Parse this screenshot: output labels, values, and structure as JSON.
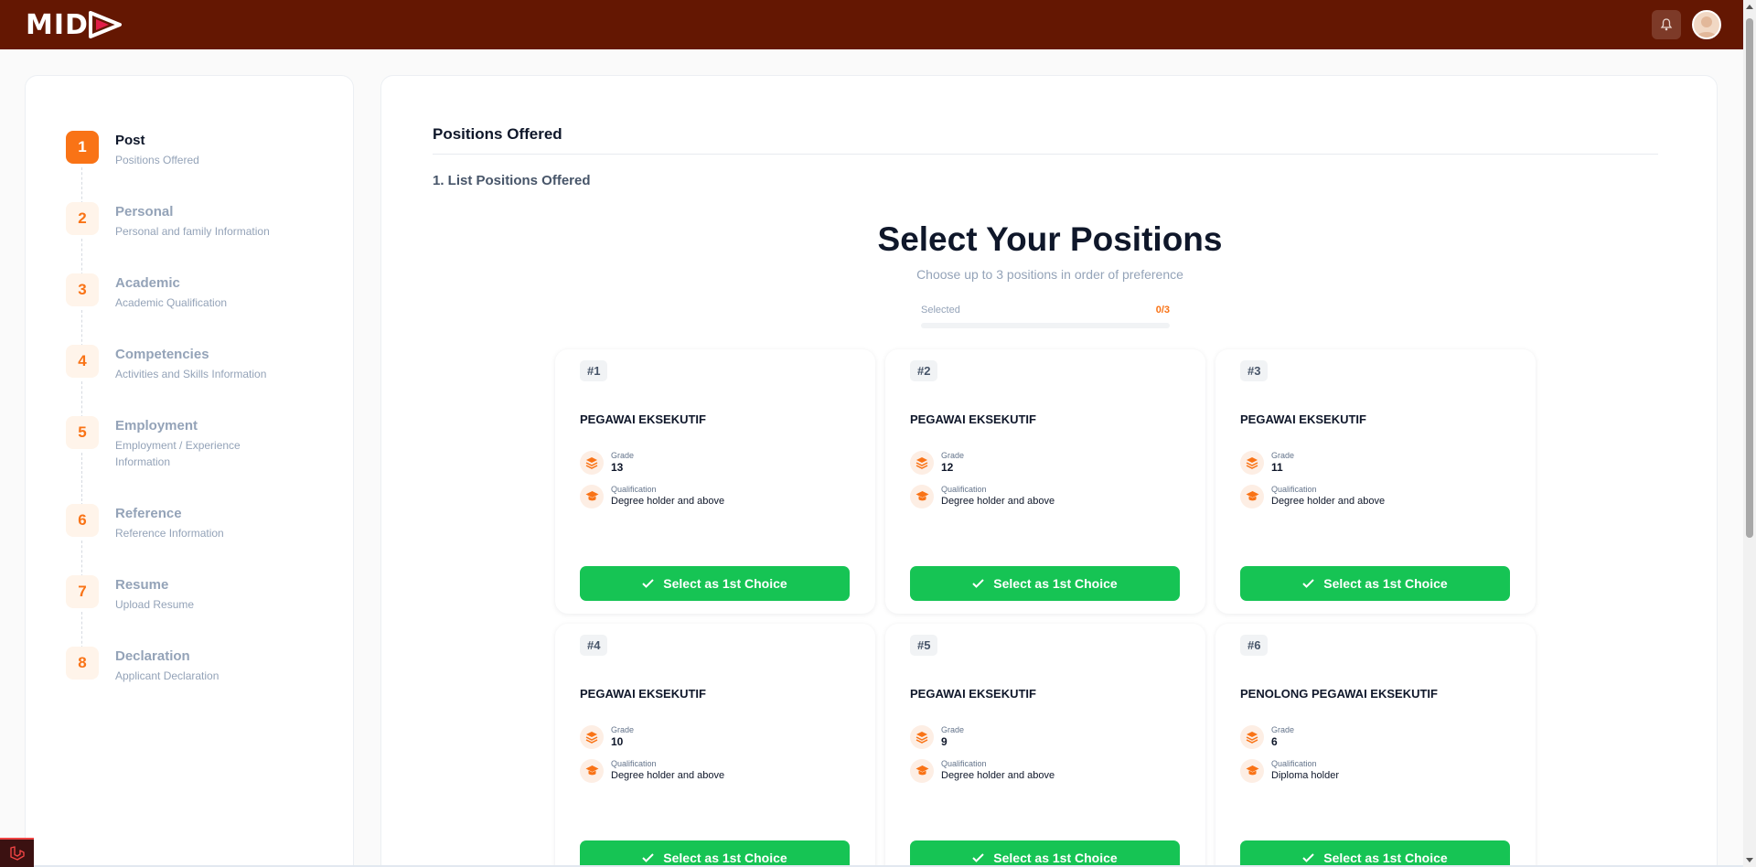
{
  "app": {
    "logo_text": "MID"
  },
  "header": {
    "notification_icon": "bell-icon",
    "avatar_icon": "user-avatar"
  },
  "sidebar": {
    "steps": [
      {
        "number": "1",
        "title": "Post",
        "subtitle": "Positions Offered",
        "active": true
      },
      {
        "number": "2",
        "title": "Personal",
        "subtitle": "Personal and family Information",
        "active": false
      },
      {
        "number": "3",
        "title": "Academic",
        "subtitle": "Academic Qualification",
        "active": false
      },
      {
        "number": "4",
        "title": "Competencies",
        "subtitle": "Activities and Skills Information",
        "active": false
      },
      {
        "number": "5",
        "title": "Employment",
        "subtitle": "Employment / Experience Information",
        "active": false
      },
      {
        "number": "6",
        "title": "Reference",
        "subtitle": "Reference Information",
        "active": false
      },
      {
        "number": "7",
        "title": "Resume",
        "subtitle": "Upload Resume",
        "active": false
      },
      {
        "number": "8",
        "title": "Declaration",
        "subtitle": "Applicant Declaration",
        "active": false
      }
    ]
  },
  "main": {
    "section_title": "Positions Offered",
    "subsection_title": "1. List Positions Offered",
    "heading": "Select Your Positions",
    "subheading": "Choose up to 3 positions in order of preference",
    "selected_label": "Selected",
    "selected_count": "0/3",
    "selected_fraction": 0,
    "grade_label": "Grade",
    "qualification_label": "Qualification",
    "select_button_label": "Select as 1st Choice",
    "positions": [
      {
        "badge": "#1",
        "title": "PEGAWAI EKSEKUTIF",
        "grade": "13",
        "qualification": "Degree holder and above"
      },
      {
        "badge": "#2",
        "title": "PEGAWAI EKSEKUTIF",
        "grade": "12",
        "qualification": "Degree holder and above"
      },
      {
        "badge": "#3",
        "title": "PEGAWAI EKSEKUTIF",
        "grade": "11",
        "qualification": "Degree holder and above"
      },
      {
        "badge": "#4",
        "title": "PEGAWAI EKSEKUTIF",
        "grade": "10",
        "qualification": "Degree holder and above"
      },
      {
        "badge": "#5",
        "title": "PEGAWAI EKSEKUTIF",
        "grade": "9",
        "qualification": "Degree holder and above"
      },
      {
        "badge": "#6",
        "title": "PENOLONG PEGAWAI EKSEKUTIF",
        "grade": "6",
        "qualification": "Diploma holder"
      }
    ]
  },
  "colors": {
    "header": "#641702",
    "accent": "#f97316",
    "button": "#16c454"
  }
}
